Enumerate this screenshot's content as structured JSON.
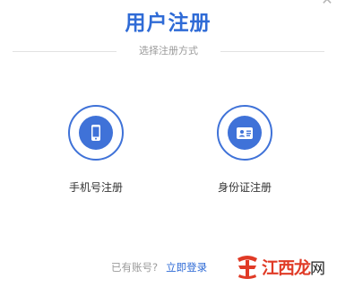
{
  "title": "用户注册",
  "subtitle": "选择注册方式",
  "options": [
    {
      "label": "手机号注册",
      "icon": "phone-icon"
    },
    {
      "label": "身份证注册",
      "icon": "id-card-icon"
    }
  ],
  "footer": {
    "question": "已有账号?",
    "login_link": "立即登录"
  },
  "watermark": {
    "text_main": "江西龙",
    "text_domain": "网"
  },
  "colors": {
    "accent": "#3f72d8",
    "title": "#2f6bd6",
    "watermark": "#e03a26"
  }
}
